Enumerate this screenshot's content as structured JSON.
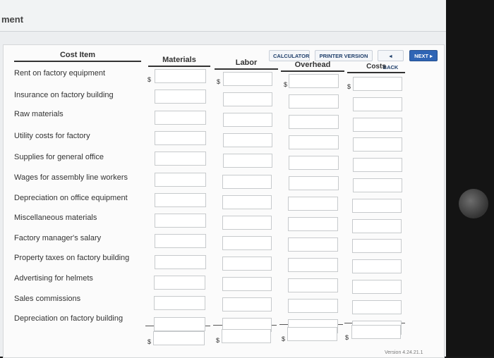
{
  "header": {
    "title": "ment"
  },
  "toolbar": {
    "calculator": "CALCULATOR",
    "printer_version": "PRINTER VERSION",
    "back": "◂ BACK",
    "next": "NEXT ▸"
  },
  "table": {
    "columns": [
      "Cost Item",
      "Materials",
      "Labor",
      "Overhead",
      "Costs"
    ],
    "rows": [
      "Rent on factory equipment",
      "Insurance on factory building",
      "Raw materials",
      "Utility costs for factory",
      "Supplies for general office",
      "Wages for assembly line workers",
      "Depreciation on office equipment",
      "Miscellaneous materials",
      "Factory manager's salary",
      "Property taxes on factory building",
      "Advertising for helmets",
      "Sales commissions",
      "Depreciation on factory building"
    ],
    "currency_symbol": "$"
  },
  "footer": {
    "version": "Version 4.24.21.1"
  }
}
